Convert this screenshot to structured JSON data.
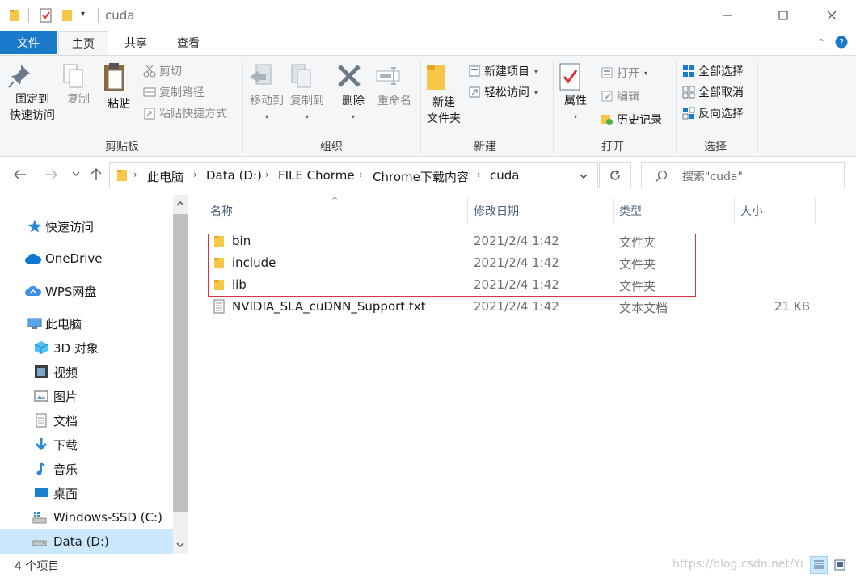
{
  "window": {
    "title": "cuda",
    "minimize": "—",
    "maximize": "☐",
    "close": "✕"
  },
  "tabs": {
    "file": "文件",
    "home": "主页",
    "share": "共享",
    "view": "查看"
  },
  "ribbon": {
    "clipboard": {
      "label": "剪贴板",
      "pin": "固定到\n快速访问",
      "pin_l1": "固定到",
      "pin_l2": "快速访问",
      "copy": "复制",
      "paste": "粘贴",
      "cut": "剪切",
      "copy_path": "复制路径",
      "paste_shortcut": "粘贴快捷方式"
    },
    "organize": {
      "label": "组织",
      "move_to": "移动到",
      "copy_to": "复制到",
      "delete": "删除",
      "rename": "重命名"
    },
    "new": {
      "label": "新建",
      "new_folder_l1": "新建",
      "new_folder_l2": "文件夹",
      "new_item": "新建项目",
      "easy_access": "轻松访问"
    },
    "open": {
      "label": "打开",
      "properties": "属性",
      "open": "打开",
      "edit": "编辑",
      "history": "历史记录"
    },
    "select": {
      "label": "选择",
      "select_all": "全部选择",
      "select_none": "全部取消",
      "invert": "反向选择"
    }
  },
  "address": {
    "crumbs": [
      "此电脑",
      "Data (D:)",
      "FILE Chorme",
      "Chrome下载内容",
      "cuda"
    ],
    "search_placeholder": "搜索\"cuda\""
  },
  "nav": {
    "quick_access": "快速访问",
    "onedrive": "OneDrive",
    "wps": "WPS网盘",
    "this_pc": "此电脑",
    "objects3d": "3D 对象",
    "videos": "视频",
    "pictures": "图片",
    "documents": "文档",
    "downloads": "下载",
    "music": "音乐",
    "desktop": "桌面",
    "windows_ssd": "Windows-SSD (C:)",
    "data_d": "Data (D:)"
  },
  "columns": {
    "name": "名称",
    "modified": "修改日期",
    "type": "类型",
    "size": "大小"
  },
  "files": [
    {
      "name": "bin",
      "modified": "2021/2/4 1:42",
      "type": "文件夹",
      "size": ""
    },
    {
      "name": "include",
      "modified": "2021/2/4 1:42",
      "type": "文件夹",
      "size": ""
    },
    {
      "name": "lib",
      "modified": "2021/2/4 1:42",
      "type": "文件夹",
      "size": ""
    },
    {
      "name": "NVIDIA_SLA_cuDNN_Support.txt",
      "modified": "2021/2/4 1:42",
      "type": "文本文档",
      "size": "21 KB"
    }
  ],
  "status": {
    "item_count": "4 个项目",
    "watermark": "https://blog.csdn.net/Yi"
  },
  "colors": {
    "accent": "#1979ca",
    "folder": "#f7c748",
    "highlight_box": "#d9363e",
    "selected_nav": "#cce8ff"
  }
}
